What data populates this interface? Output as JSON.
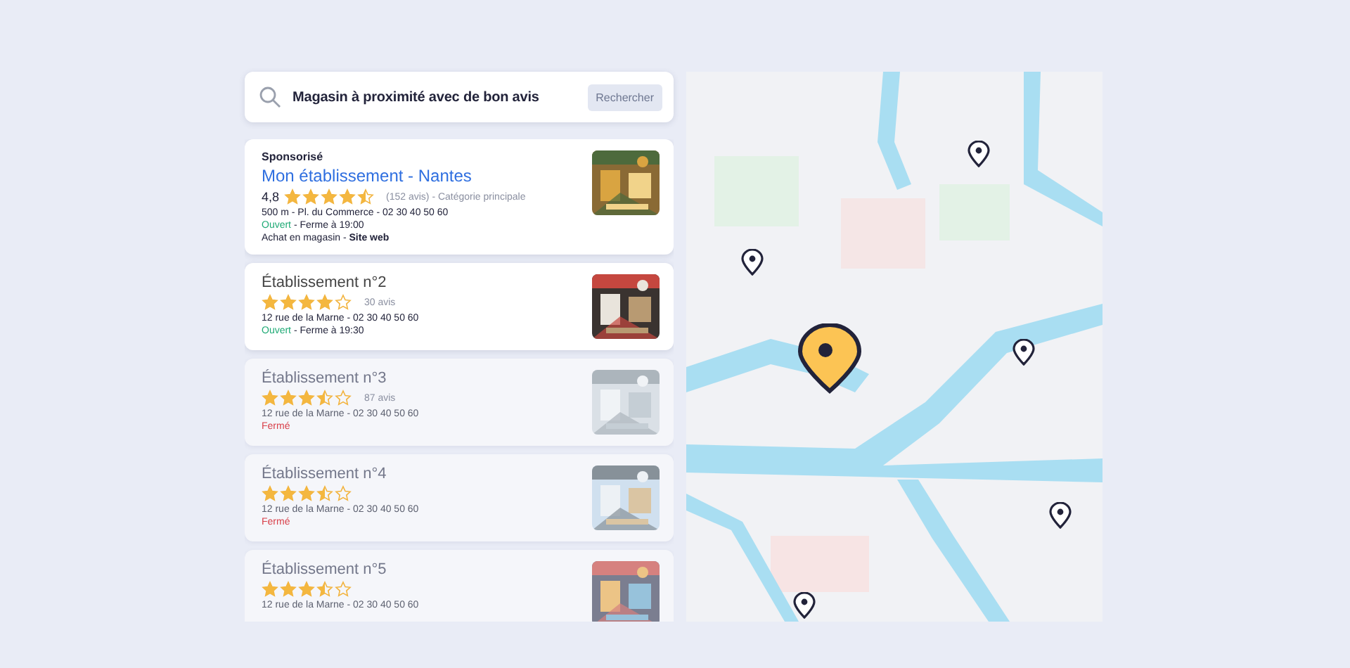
{
  "search": {
    "value": "Magasin à proximité avec de bon avis",
    "button": {
      "label": "Rechercher",
      "disabled": true
    }
  },
  "results": [
    {
      "sponsor": "Sponsorisé",
      "title": "Mon établissement - Nantes",
      "rating": "4,8",
      "stars": 4.5,
      "reviews": "(152 avis) - Catégorie principale",
      "address": "500 m - Pl. du Commerce - 02 30 40 50 60",
      "status": "Ouvert",
      "open": true,
      "hours": " - Ferme à 19:00",
      "links": "Achat en magasin - ",
      "link": "Site web",
      "dimmed": false
    },
    {
      "title": "Établissement n°2",
      "stars": 4,
      "reviews": "30 avis",
      "address": "12 rue de la Marne - 02 30 40 50 60",
      "status": "Ouvert",
      "open": true,
      "hours": " - Ferme à 19:30",
      "dimmed": false
    },
    {
      "title": "Établissement n°3",
      "stars": 3.5,
      "reviews": "87 avis",
      "address": "12 rue de la Marne - 02 30 40 50 60",
      "status": "Fermé",
      "open": false,
      "dimmed": true
    },
    {
      "title": "Établissement n°4",
      "stars": 3.5,
      "address": "12 rue de la Marne - 02 30 40 50 60",
      "status": "Fermé",
      "open": false,
      "dimmed": true
    },
    {
      "title": "Établissement n°5",
      "stars": 3.5,
      "address": "12 rue de la Marne - 02 30 40 50 60",
      "dimmed": true
    }
  ],
  "map": {
    "pins": [
      {
        "selected": true
      },
      {
        "selected": false
      },
      {
        "selected": false
      },
      {
        "selected": false
      },
      {
        "selected": false
      },
      {
        "selected": false
      }
    ]
  }
}
